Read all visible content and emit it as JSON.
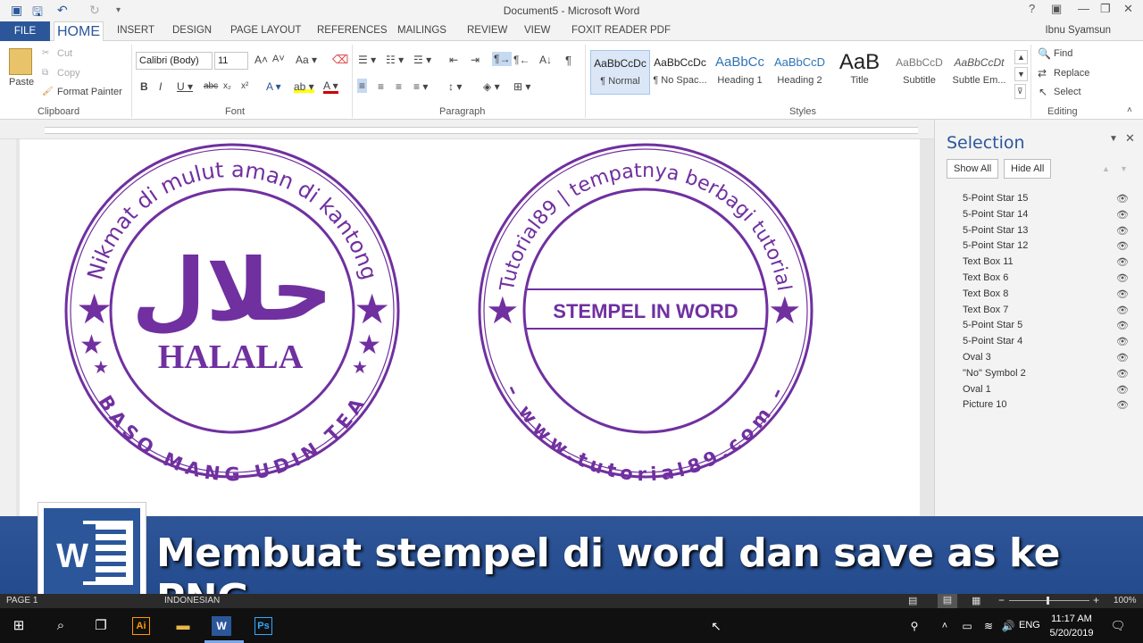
{
  "title_bar": {
    "document_title": "Document5 - Microsoft Word",
    "help": "?",
    "minimize": "—",
    "restore": "❐",
    "close": "✕"
  },
  "tabs": [
    "FILE",
    "HOME",
    "INSERT",
    "DESIGN",
    "PAGE LAYOUT",
    "REFERENCES",
    "MAILINGS",
    "REVIEW",
    "VIEW",
    "FOXIT READER PDF"
  ],
  "user": "Ibnu Syamsun",
  "ribbon": {
    "clipboard": {
      "paste": "Paste",
      "cut": "Cut",
      "copy": "Copy",
      "format_painter": "Format Painter",
      "label": "Clipboard"
    },
    "font": {
      "name": "Calibri (Body)",
      "size": "11",
      "label": "Font"
    },
    "paragraph": {
      "label": "Paragraph"
    },
    "styles": {
      "items": [
        {
          "sample": "AaBbCcDc",
          "name": "¶ Normal"
        },
        {
          "sample": "AaBbCcDc",
          "name": "¶ No Spac..."
        },
        {
          "sample": "AaBbCc",
          "name": "Heading 1"
        },
        {
          "sample": "AaBbCcD",
          "name": "Heading 2"
        },
        {
          "sample": "AaB",
          "name": "Title"
        },
        {
          "sample": "AaBbCcD",
          "name": "Subtitle"
        },
        {
          "sample": "AaBbCcDt",
          "name": "Subtle Em..."
        }
      ],
      "label": "Styles"
    },
    "editing": {
      "find": "Find",
      "replace": "Replace",
      "select": "Select",
      "label": "Editing"
    }
  },
  "stamp1": {
    "top_text": "Nikmat di mulut aman di kantong",
    "arabic": "حلال",
    "center": "HALALA",
    "bottom_text": "BASO MANG UDIN TEA"
  },
  "stamp2": {
    "top_text": "Tutorial89 | tempatnya berbagi tutorial",
    "center": "STEMPEL IN WORD",
    "bottom_text": "– www.tutorial89.com –"
  },
  "selection_pane": {
    "title": "Selection",
    "show_all": "Show All",
    "hide_all": "Hide All",
    "items": [
      "5-Point Star 15",
      "5-Point Star 14",
      "5-Point Star 13",
      "5-Point Star 12",
      "Text Box 11",
      "Text Box 6",
      "Text Box 8",
      "Text Box 7",
      "5-Point Star 5",
      "5-Point Star 4",
      "Oval 3",
      "\"No\" Symbol 2",
      "Oval 1",
      "Picture 10"
    ]
  },
  "banner": {
    "text": "Membuat stempel di word dan save as ke PNG"
  },
  "status": {
    "page": "PAGE 1",
    "language": "INDONESIAN",
    "zoom": "100%"
  },
  "taskbar": {
    "time": "11:17 AM",
    "date": "5/20/2019",
    "lang": "ENG"
  },
  "colors": {
    "stamp": "#7030a0",
    "accent": "#2b579a"
  }
}
